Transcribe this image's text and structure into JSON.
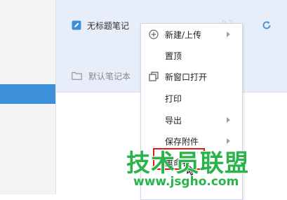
{
  "note": {
    "title": "无标题笔记",
    "faint_text": "0 2",
    "icon": "note-pencil-icon",
    "sync_icon": "refresh-icon"
  },
  "notebook": {
    "label": "默认笔记本",
    "icon": "folder-icon"
  },
  "context_menu": {
    "items": [
      {
        "label": "新建/上传",
        "icon": "plus-circle-icon",
        "submenu": true
      },
      {
        "label": "置顶",
        "submenu": false
      },
      {
        "label": "新窗口打开",
        "icon": "new-window-icon",
        "submenu": false
      },
      {
        "label": "打印",
        "submenu": false
      },
      {
        "label": "导出",
        "submenu": true
      },
      {
        "label": "保存附件",
        "submenu": true
      },
      {
        "label": "重命名",
        "submenu": false
      }
    ]
  },
  "watermark": {
    "title": "技术员联盟",
    "url": "www.jsgho.com"
  },
  "colors": {
    "accent_blue": "#3c8fd9",
    "selected_bg": "#e7edf9",
    "highlight_red": "#e11919",
    "watermark_green": "#29b44a"
  }
}
